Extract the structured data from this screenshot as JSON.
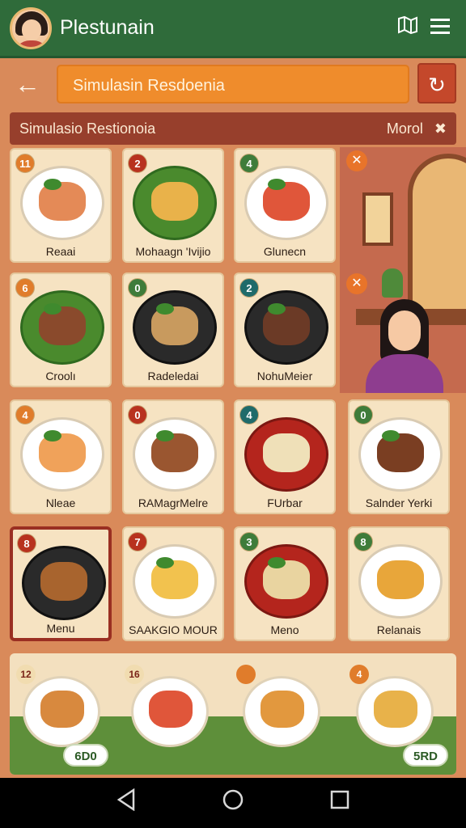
{
  "app": {
    "title": "Plestunain"
  },
  "search": {
    "value": "Simulasin Resdoenia"
  },
  "subheader": {
    "title": "Simulasio Restionoia",
    "mode": "Morol"
  },
  "icons": {
    "map": "map-icon",
    "menu": "hamburger-menu-icon",
    "back": "back-arrow-icon",
    "refresh": "refresh-icon",
    "tools": "tools-icon"
  },
  "colors": {
    "header_green": "#2f6b3a",
    "search_orange": "#ef8c2c",
    "accent_red": "#c4482b",
    "card_bg": "#f6e3c2"
  },
  "menu_items": [
    {
      "badge": "11",
      "label": "Reaai"
    },
    {
      "badge": "2",
      "label": "Mohaagn 'Ivijio"
    },
    {
      "badge": "4",
      "label": "Glunecn"
    },
    {
      "badge": "6",
      "label": "Croolı"
    },
    {
      "badge": "0",
      "label": "Radeledai"
    },
    {
      "badge": "2",
      "label": "NohuMeier"
    },
    {
      "badge": "4",
      "label": "Nleae"
    },
    {
      "badge": "0",
      "label": "RAMagrMelre"
    },
    {
      "badge": "4",
      "label": "FUrbar"
    },
    {
      "badge": "0",
      "label": "Salnder Yerki"
    },
    {
      "badge": "8",
      "label": "Menu"
    },
    {
      "badge": "7",
      "label": "SAAKGIO MOUR"
    },
    {
      "badge": "3",
      "label": "Meno"
    },
    {
      "badge": "8",
      "label": "Relanais"
    }
  ],
  "tray": {
    "items": [
      {
        "badge": "12"
      },
      {
        "badge": "16"
      },
      {
        "badge": ""
      },
      {
        "badge": "4"
      }
    ],
    "left_pill": "6D0",
    "right_pill": "5RD"
  }
}
